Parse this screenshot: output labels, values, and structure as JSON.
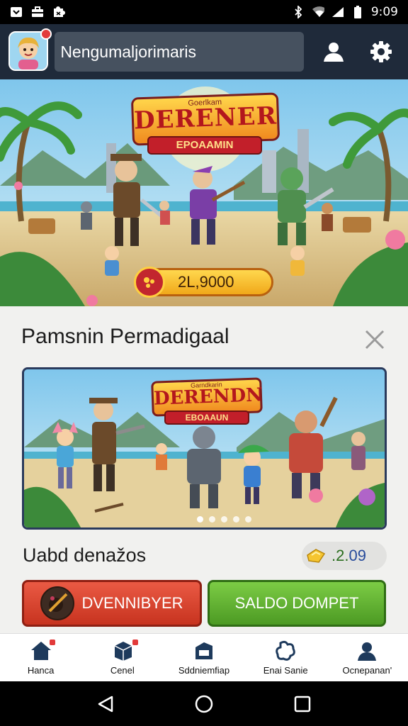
{
  "status_bar": {
    "time": "9:09",
    "icons": [
      "download-icon",
      "briefcase-icon",
      "puzzle-icon",
      "bluetooth-icon",
      "wifi-icon",
      "signal-icon",
      "battery-icon"
    ]
  },
  "header": {
    "title": "Nengumaljorimaris",
    "profile_icon": "person-icon",
    "settings_icon": "gear-icon"
  },
  "hero": {
    "small_caption": "Goerlkam",
    "title": "DERENER",
    "subtitle": "EPOAAMIN",
    "coins": "2L,9000"
  },
  "section": {
    "title": "Pamsnin Permadigaal",
    "card": {
      "small_caption": "Garndkarin",
      "title": "DERENDN",
      "subtitle": "EBOAAUN",
      "dots": 5,
      "active_dot": 0
    }
  },
  "reward": {
    "label": "Uabd denažos",
    "value_prefix": ".2.",
    "value_suffix": "09"
  },
  "actions": {
    "primary_label": "DVENNIBYER",
    "secondary_label": "SALDO DOMPET"
  },
  "bottom_nav": [
    {
      "label": "Hanca",
      "icon": "home-icon",
      "badge": true
    },
    {
      "label": "Cenel",
      "icon": "box-icon",
      "badge": true
    },
    {
      "label": "Sddniemfiap",
      "icon": "building-icon",
      "badge": false
    },
    {
      "label": "Enai Sanie",
      "icon": "puzzle-icon",
      "badge": false
    },
    {
      "label": "Ocnepanan'",
      "icon": "user-icon",
      "badge": false
    }
  ],
  "colors": {
    "header_bg": "#1f2a3a",
    "red_button": "#d5412c",
    "green_button": "#5fae30",
    "coin_gold": "#f4b82a"
  }
}
